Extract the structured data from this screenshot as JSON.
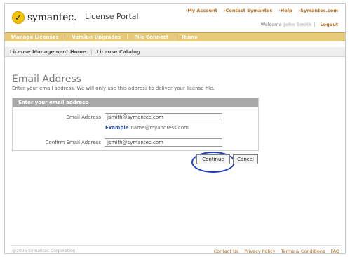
{
  "brand": {
    "logo_glyph": "✓",
    "name": "symantec.",
    "portal_title": "License Portal",
    "accent": "#e7c97a"
  },
  "top_links": [
    "›My Account",
    "›Contact Symantec",
    "›Help",
    "›Symantec.com"
  ],
  "welcome": {
    "prefix": "Welcome",
    "user": "John Smith",
    "separator": "|",
    "logout": "Logout"
  },
  "nav_primary": [
    "Manage Licenses",
    "Version Upgrades",
    "File Connect",
    "Home"
  ],
  "nav_secondary": [
    "License Management Home",
    "License Catalog"
  ],
  "page": {
    "title": "Email Address",
    "description": "Enter your email address. We will only use this address to deliver your license file."
  },
  "form": {
    "header": "Enter your email address",
    "email_label": "Email Address",
    "email_value": "jsmith@symantec.com",
    "example_label": "Example",
    "example_value": "name@myaddress.com",
    "confirm_label": "Confirm Email Address",
    "confirm_value": "jsmith@symantec.com"
  },
  "buttons": {
    "continue": "Continue",
    "cancel": "Cancel"
  },
  "footer": {
    "copyright": "@2006 Symantec Corporation",
    "links": [
      "Contact Us",
      "Privacy Policy",
      "Terms & Conditions",
      "FAQ"
    ],
    "separator": "·"
  }
}
